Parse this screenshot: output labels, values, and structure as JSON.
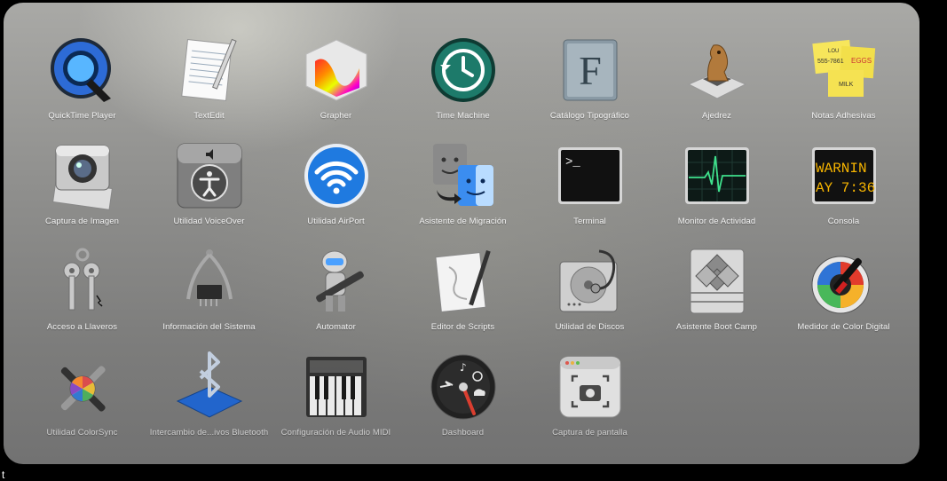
{
  "folder": {
    "apps": [
      {
        "label": "QuickTime Player",
        "icon": "quicktime-icon"
      },
      {
        "label": "TextEdit",
        "icon": "textedit-icon"
      },
      {
        "label": "Grapher",
        "icon": "grapher-icon"
      },
      {
        "label": "Time Machine",
        "icon": "time-machine-icon"
      },
      {
        "label": "Catálogo Tipográfico",
        "icon": "font-book-icon"
      },
      {
        "label": "Ajedrez",
        "icon": "chess-icon"
      },
      {
        "label": "Notas Adhesivas",
        "icon": "stickies-icon"
      },
      {
        "label": "Captura de Imagen",
        "icon": "image-capture-icon"
      },
      {
        "label": "Utilidad VoiceOver",
        "icon": "voiceover-icon"
      },
      {
        "label": "Utilidad AirPort",
        "icon": "airport-icon"
      },
      {
        "label": "Asistente de Migración",
        "icon": "migration-assistant-icon"
      },
      {
        "label": "Terminal",
        "icon": "terminal-icon"
      },
      {
        "label": "Monitor de Actividad",
        "icon": "activity-monitor-icon"
      },
      {
        "label": "Consola",
        "icon": "console-icon"
      },
      {
        "label": "Acceso a Llaveros",
        "icon": "keychain-icon"
      },
      {
        "label": "Información del Sistema",
        "icon": "system-information-icon"
      },
      {
        "label": "Automator",
        "icon": "automator-icon"
      },
      {
        "label": "Editor de Scripts",
        "icon": "script-editor-icon"
      },
      {
        "label": "Utilidad de Discos",
        "icon": "disk-utility-icon"
      },
      {
        "label": "Asistente Boot Camp",
        "icon": "boot-camp-icon"
      },
      {
        "label": "Medidor de Color Digital",
        "icon": "color-meter-icon"
      },
      {
        "label": "Utilidad ColorSync",
        "icon": "colorsync-icon"
      },
      {
        "label": "Intercambio de...ivos Bluetooth",
        "icon": "bluetooth-icon"
      },
      {
        "label": "Configuración de Audio MIDI",
        "icon": "midi-icon"
      },
      {
        "label": "Dashboard",
        "icon": "dashboard-icon"
      },
      {
        "label": "Captura de pantalla",
        "icon": "screenshot-icon"
      }
    ],
    "icon_text": {
      "terminal_prompt": ">_",
      "console_line1": "WARNIN",
      "console_line2": "AY 7:36",
      "font_book_letter": "F",
      "sticky_note1": "555-7861",
      "sticky_note2": "EGGS",
      "sticky_note3": "MILK",
      "sticky_note0": "LOU"
    }
  },
  "bottom_text": "t"
}
